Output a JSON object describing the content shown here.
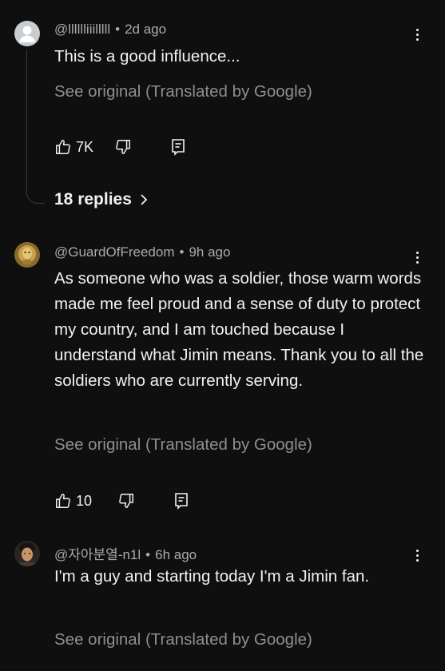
{
  "comments": [
    {
      "handle": "@lllllliiilllll",
      "time": "2d ago",
      "text": "This is a good influence...",
      "see_original": "See original (Translated by Google)",
      "likes": "7K",
      "replies": "18 replies",
      "avatar": "default-avatar-icon"
    },
    {
      "handle": "@GuardOfFreedom",
      "time": "9h ago",
      "text": "As someone who was a soldier, those warm words made me feel proud and a sense of duty to protect my country, and I am touched because I understand what Jimin means. Thank you to all the soldiers who are currently serving.",
      "see_original": "See original (Translated by Google)",
      "likes": "10",
      "avatar": "gold-avatar"
    },
    {
      "handle": "@자아분열-n1l",
      "time": "6h ago",
      "text": "I'm a guy and starting today I'm a Jimin fan.",
      "see_original": "See original (Translated by Google)",
      "avatar": "photo-avatar"
    }
  ],
  "separator": "•",
  "colors": {
    "background": "#0f0f0f",
    "text": "#f1f1f1",
    "meta": "#aaaaaa",
    "muted": "#8e8e8e"
  }
}
